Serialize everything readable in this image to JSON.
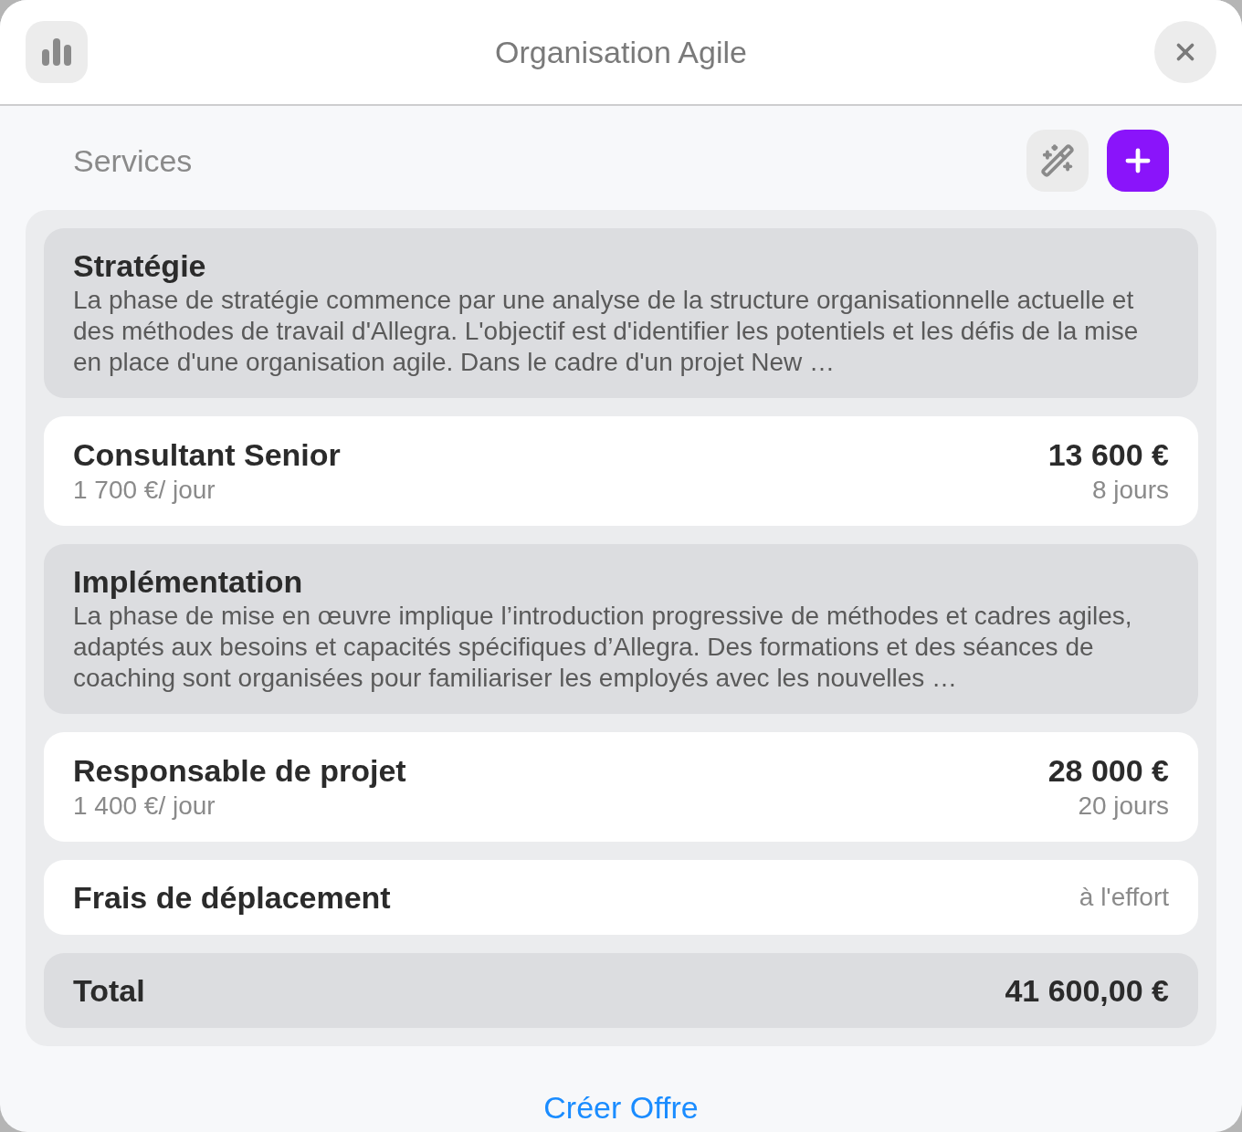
{
  "window": {
    "title": "Organisation Agile"
  },
  "section": {
    "title": "Services"
  },
  "items": [
    {
      "kind": "phase",
      "title": "Stratégie",
      "description": "La phase de stratégie commence par une analyse de la structure organisationnelle actuelle et des méthodes de travail d'Allegra. L'objectif est d'identifier les potentiels et les défis de la mise en place d'une organisation agile. Dans le cadre d'un projet New …"
    },
    {
      "kind": "role",
      "title": "Consultant Senior",
      "rate": "1 700 €/ jour",
      "amount": "13 600 €",
      "duration": "8 jours"
    },
    {
      "kind": "phase",
      "title": "Implémentation",
      "description": "La phase de mise en œuvre implique l’introduction progressive de méthodes et cadres agiles, adaptés aux besoins et capacités spécifiques d’Allegra. Des formations et des séances de coaching sont organisées pour familiariser les employés avec les nouvelles …"
    },
    {
      "kind": "role",
      "title": "Responsable de projet",
      "rate": "1 400 €/ jour",
      "amount": "28 000 €",
      "duration": "20 jours"
    },
    {
      "kind": "expense",
      "title": "Frais de déplacement",
      "note": "à l'effort"
    }
  ],
  "total": {
    "label": "Total",
    "amount": "41 600,00 €"
  },
  "action": {
    "label": "Créer Offre"
  }
}
